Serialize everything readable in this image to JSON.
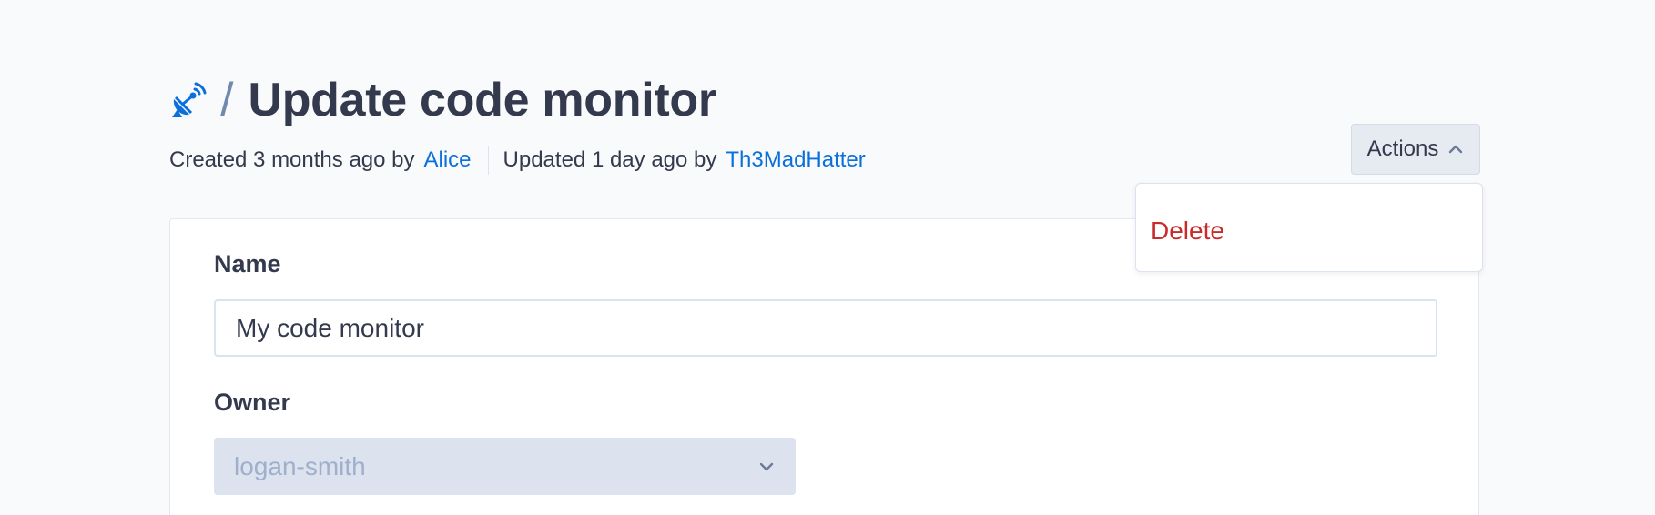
{
  "header": {
    "icon": "satellite-dish-icon",
    "separator": "/",
    "title": "Update code monitor"
  },
  "meta": {
    "created_text": "Created 3 months ago by",
    "created_by": "Alice",
    "updated_text": "Updated 1 day ago by",
    "updated_by": "Th3MadHatter"
  },
  "actions": {
    "label": "Actions",
    "icon": "chevron-up-icon",
    "menu": [
      {
        "label": "Delete",
        "color": "#c92a2a"
      }
    ]
  },
  "form": {
    "name_label": "Name",
    "name_value": "My code monitor",
    "owner_label": "Owner",
    "owner_value": "logan-smith",
    "owner_icon": "chevron-down-icon"
  },
  "colors": {
    "link": "#0b70db",
    "danger": "#c92a2a",
    "text": "#343a4d",
    "background": "#f9fafb"
  }
}
